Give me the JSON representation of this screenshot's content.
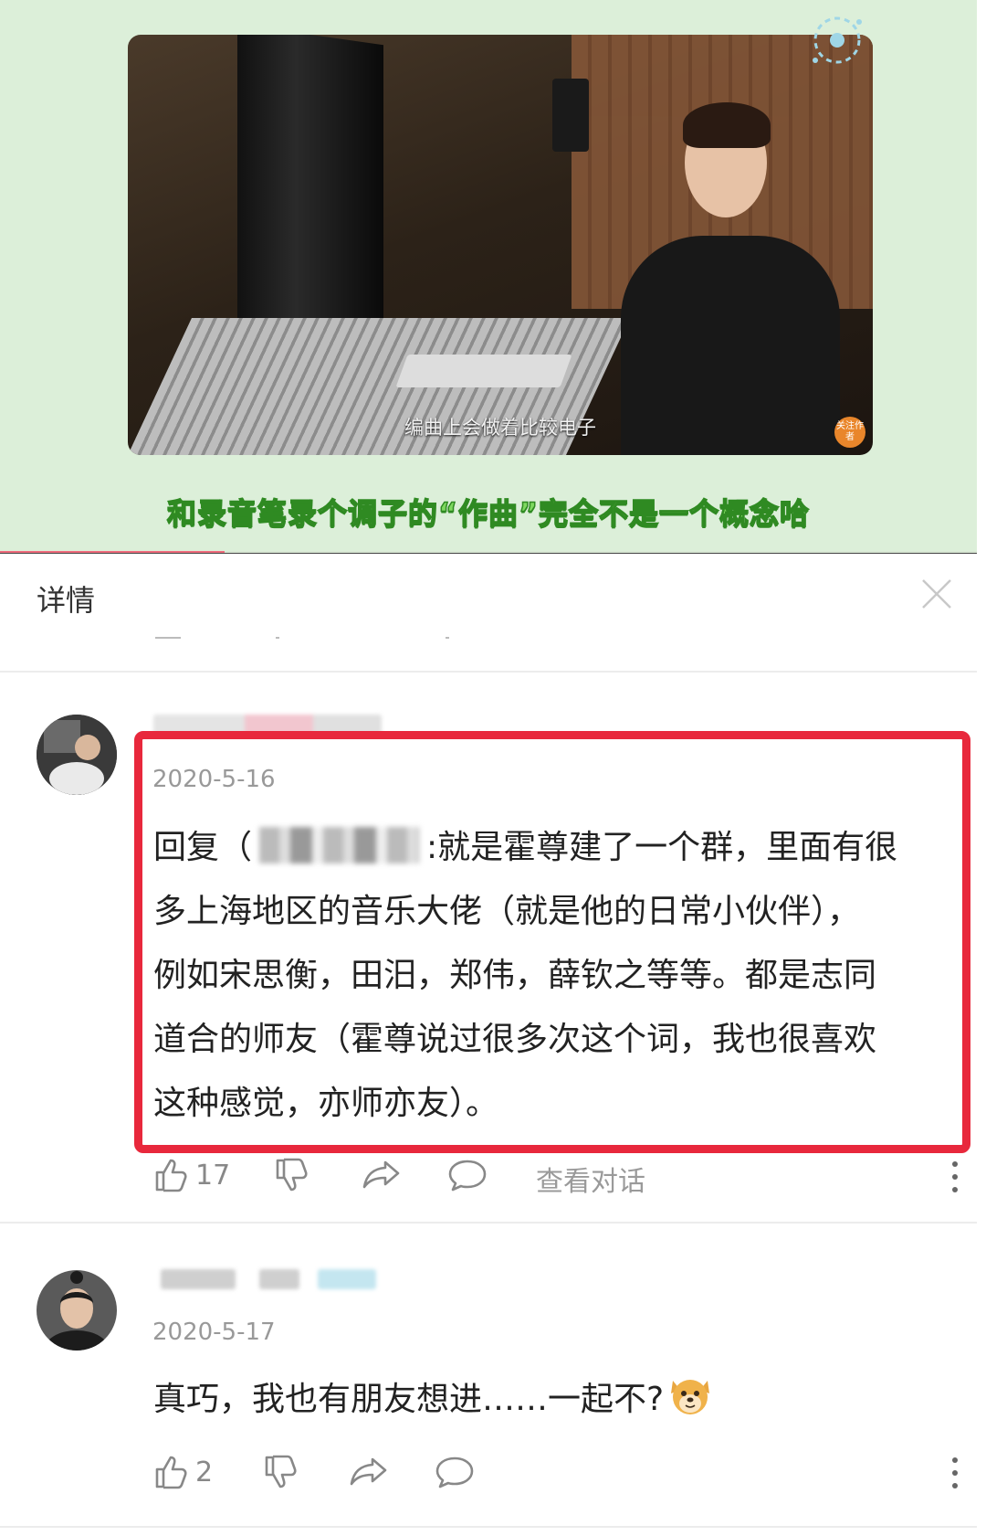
{
  "video": {
    "subtitle": "编曲上会做着比较电子",
    "caption": "和录音笔录个调子的“作曲”完全不是一个概念哈",
    "badge_text": "关注作者",
    "progress": 0.23,
    "colors": {
      "background": "#dcefd9",
      "caption": "#7ed860",
      "progress": "#f06c7d"
    }
  },
  "header": {
    "title": "详情",
    "close_icon": "close-icon"
  },
  "comments": [
    {
      "date": "2020-5-16",
      "reply_prefix": "回复（",
      "text_line1": ":就是霍尊建了一个群，里面有很",
      "text_rest": [
        "多上海地区的音乐大佬（就是他的日常小伙伴），",
        "例如宋思衡，田汨，郑伟，薛钦之等等。都是志同",
        "道合的师友（霍尊说过很多次这个词，我也很喜欢",
        "这种感觉，亦师亦友）。"
      ],
      "likes": "17",
      "view_conversation": "查看对话",
      "highlight_color": "#e8283c"
    },
    {
      "date": "2020-5-17",
      "text": "真巧，我也有朋友想进……一起不?",
      "emoji": "doge-emoji",
      "likes": "2"
    }
  ],
  "icons": [
    "thumbs-up-icon",
    "thumbs-down-icon",
    "share-icon",
    "comment-icon",
    "more-icon"
  ]
}
